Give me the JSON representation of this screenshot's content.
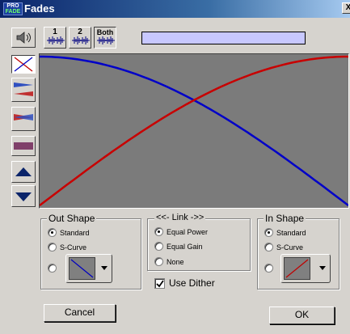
{
  "window": {
    "title": "Fades",
    "icon_top": "PRO",
    "icon_bottom": "FADE",
    "close": "X"
  },
  "toolbar": {
    "btn_1": "1",
    "btn_2": "2",
    "btn_both": "Both"
  },
  "out_shape": {
    "title": "Out Shape",
    "options": [
      "Standard",
      "S-Curve"
    ],
    "selected": "Standard"
  },
  "link": {
    "title": "<<- Link ->>",
    "options": [
      "Equal Power",
      "Equal Gain",
      "None"
    ],
    "selected": "Equal Power"
  },
  "in_shape": {
    "title": "In Shape",
    "options": [
      "Standard",
      "S-Curve"
    ],
    "selected": "Standard"
  },
  "dither": {
    "label": "Use Dither",
    "checked": true
  },
  "buttons": {
    "cancel": "Cancel",
    "ok": "OK"
  },
  "colors": {
    "fade_out_curve": "#0000c8",
    "fade_in_curve": "#c80000",
    "plot_bg": "#7b7b7b",
    "progress_fill": "#c8c8ff"
  },
  "chart_data": {
    "type": "line",
    "series": [
      {
        "values": [
          1.0,
          0.0
        ]
      },
      {
        "values": [
          0.0,
          1.0
        ]
      }
    ],
    "curve": "equal power"
  }
}
